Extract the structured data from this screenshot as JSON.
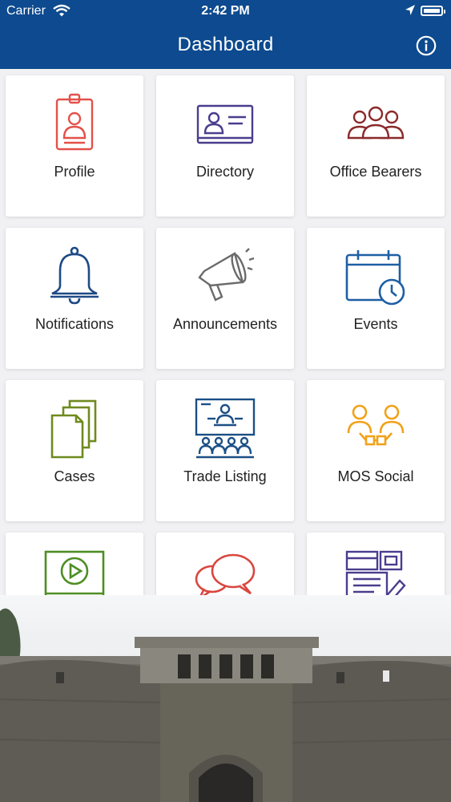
{
  "status": {
    "carrier": "Carrier",
    "time": "2:42 PM"
  },
  "nav": {
    "title": "Dashboard"
  },
  "colors": {
    "nav_bg": "#0d4a8f"
  },
  "tiles": [
    {
      "label": "Profile",
      "icon": "id-badge-icon",
      "color": "#e3514a"
    },
    {
      "label": "Directory",
      "icon": "contact-card-icon",
      "color": "#4b3d8e"
    },
    {
      "label": "Office Bearers",
      "icon": "people-group-icon",
      "color": "#8b2a2a"
    },
    {
      "label": "Notifications",
      "icon": "bell-icon",
      "color": "#1e4a86"
    },
    {
      "label": "Announcements",
      "icon": "megaphone-icon",
      "color": "#6b6b6b"
    },
    {
      "label": "Events",
      "icon": "calendar-clock-icon",
      "color": "#1e5fa3"
    },
    {
      "label": "Cases",
      "icon": "documents-icon",
      "color": "#6f8a1f"
    },
    {
      "label": "Trade Listing",
      "icon": "presentation-icon",
      "color": "#1b4f86"
    },
    {
      "label": "MOS Social",
      "icon": "social-network-icon",
      "color": "#f0a21a"
    },
    {
      "label": "",
      "icon": "video-player-icon",
      "color": "#4e8e24"
    },
    {
      "label": "",
      "icon": "chat-bubbles-icon",
      "color": "#d9473f"
    },
    {
      "label": "",
      "icon": "form-edit-icon",
      "color": "#4b3d8e"
    }
  ]
}
